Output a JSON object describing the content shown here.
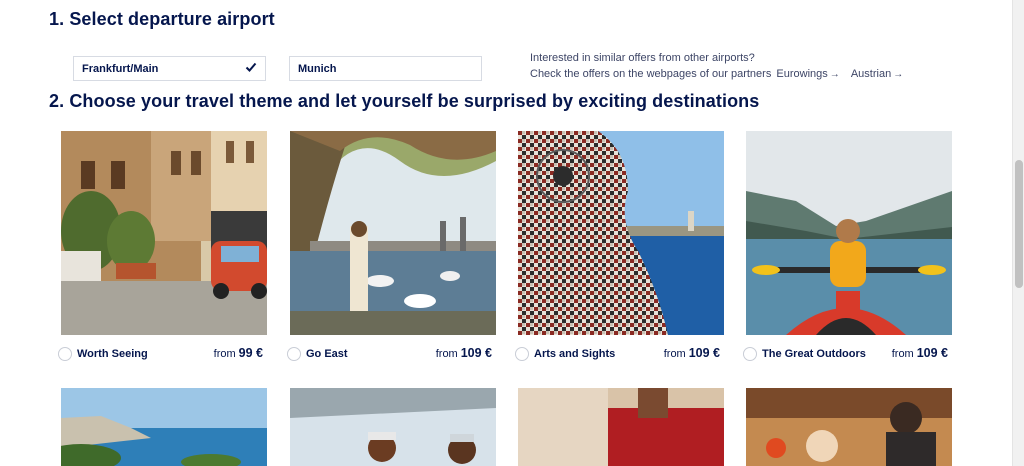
{
  "section1": {
    "title": "1. Select departure airport"
  },
  "airports": [
    {
      "label": "Frankfurt/Main",
      "selected": true
    },
    {
      "label": "Munich",
      "selected": false
    }
  ],
  "partners": {
    "line1": "Interested in similar offers from other airports?",
    "line2": "Check the offers on the webpages of our partners",
    "link1": "Eurowings",
    "link2": "Austrian",
    "arrow": "→"
  },
  "section2": {
    "title": "2. Choose your travel theme and let yourself be surprised by exciting destinations"
  },
  "themes": [
    {
      "name": "Worth Seeing",
      "from": "from",
      "price": "99 €"
    },
    {
      "name": "Go East",
      "from": "from",
      "price": "109 €"
    },
    {
      "name": "Arts and Sights",
      "from": "from",
      "price": "109 €"
    },
    {
      "name": "The Great Outdoors",
      "from": "from",
      "price": "109 €"
    }
  ],
  "colors": {
    "brand": "#05164d",
    "border": "#d7dbe3"
  },
  "icons": {
    "check": "checkmark-icon",
    "arrow": "arrow-right-icon"
  }
}
